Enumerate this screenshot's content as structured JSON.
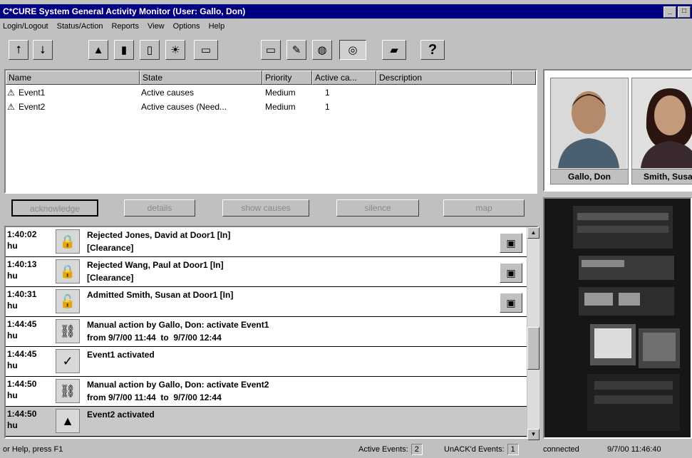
{
  "window": {
    "title": "C*CURE System General Activity Monitor (User: Gallo, Don)"
  },
  "menu": [
    "Login/Logout",
    "Status/Action",
    "Reports",
    "View",
    "Options",
    "Help"
  ],
  "toolbar": {
    "buttons": [
      {
        "name": "upload-icon",
        "glyph": "⭡"
      },
      {
        "name": "download-icon",
        "glyph": "⭣"
      },
      {
        "name": "alarm-triangle-icon",
        "glyph": "▲"
      },
      {
        "name": "door-icon",
        "glyph": "▮"
      },
      {
        "name": "device-icon",
        "glyph": "▯"
      },
      {
        "name": "lightbulb-icon",
        "glyph": "☀"
      },
      {
        "name": "monitor-graph-icon",
        "glyph": "▭"
      },
      {
        "name": "window-icon",
        "glyph": "▭"
      },
      {
        "name": "edit-icon",
        "glyph": "✎"
      },
      {
        "name": "globe-icon",
        "glyph": "◍"
      },
      {
        "name": "camera-icon",
        "glyph": "◎"
      },
      {
        "name": "parallelogram-icon",
        "glyph": "▰"
      },
      {
        "name": "help-icon",
        "glyph": "?"
      }
    ]
  },
  "events": {
    "columns": [
      "Name",
      "State",
      "Priority",
      "Active ca...",
      "Description"
    ],
    "rows": [
      {
        "name": "Event1",
        "state": "Active causes",
        "priority": "Medium",
        "active": "1",
        "description": ""
      },
      {
        "name": "Event2",
        "state": "Active causes (Need...",
        "priority": "Medium",
        "active": "1",
        "description": ""
      }
    ]
  },
  "actions": [
    "acknowledge",
    "details",
    "show causes",
    "silence",
    "map"
  ],
  "activity": [
    {
      "time": "1:40:02\nhu",
      "icon": "lock-icon",
      "glyph": "🔒",
      "message": "Rejected Jones, David at Door1 [In]\n[Clearance]",
      "has_video": true
    },
    {
      "time": "1:40:13\nhu",
      "icon": "lock-icon",
      "glyph": "🔒",
      "message": "Rejected Wang, Paul at Door1 [In]\n[Clearance]",
      "has_video": true
    },
    {
      "time": "1:40:31\nhu",
      "icon": "lock-icon",
      "glyph": "🔓",
      "message": "Admitted Smith, Susan at Door1 [In]",
      "has_video": true
    },
    {
      "time": "1:44:45\nhu",
      "icon": "network-icon",
      "glyph": "⛓",
      "message": "Manual action by Gallo, Don: activate Event1\nfrom 9/7/00 11:44  to  9/7/00 12:44",
      "has_video": false
    },
    {
      "time": "1:44:45\nhu",
      "icon": "checkmark-icon",
      "glyph": "✓",
      "message": "Event1 activated",
      "has_video": false
    },
    {
      "time": "1:44:50\nhu",
      "icon": "network-icon",
      "glyph": "⛓",
      "message": "Manual action by Gallo, Don: activate Event2\nfrom 9/7/00 11:44  to  9/7/00 12:44",
      "has_video": false
    },
    {
      "time": "1:44:50\nhu",
      "icon": "alarm-triangle-icon",
      "glyph": "▲",
      "message": "Event2 activated",
      "has_video": false
    }
  ],
  "photos": [
    {
      "caption": "Gallo, Don"
    },
    {
      "caption": "Smith, Susan"
    }
  ],
  "status": {
    "help": "or Help, press F1",
    "active_label": "Active Events:",
    "active_value": "2",
    "unack_label": "UnACK'd Events:",
    "unack_value": "1",
    "connection": "connected",
    "datetime": "9/7/00 11:46:40"
  }
}
